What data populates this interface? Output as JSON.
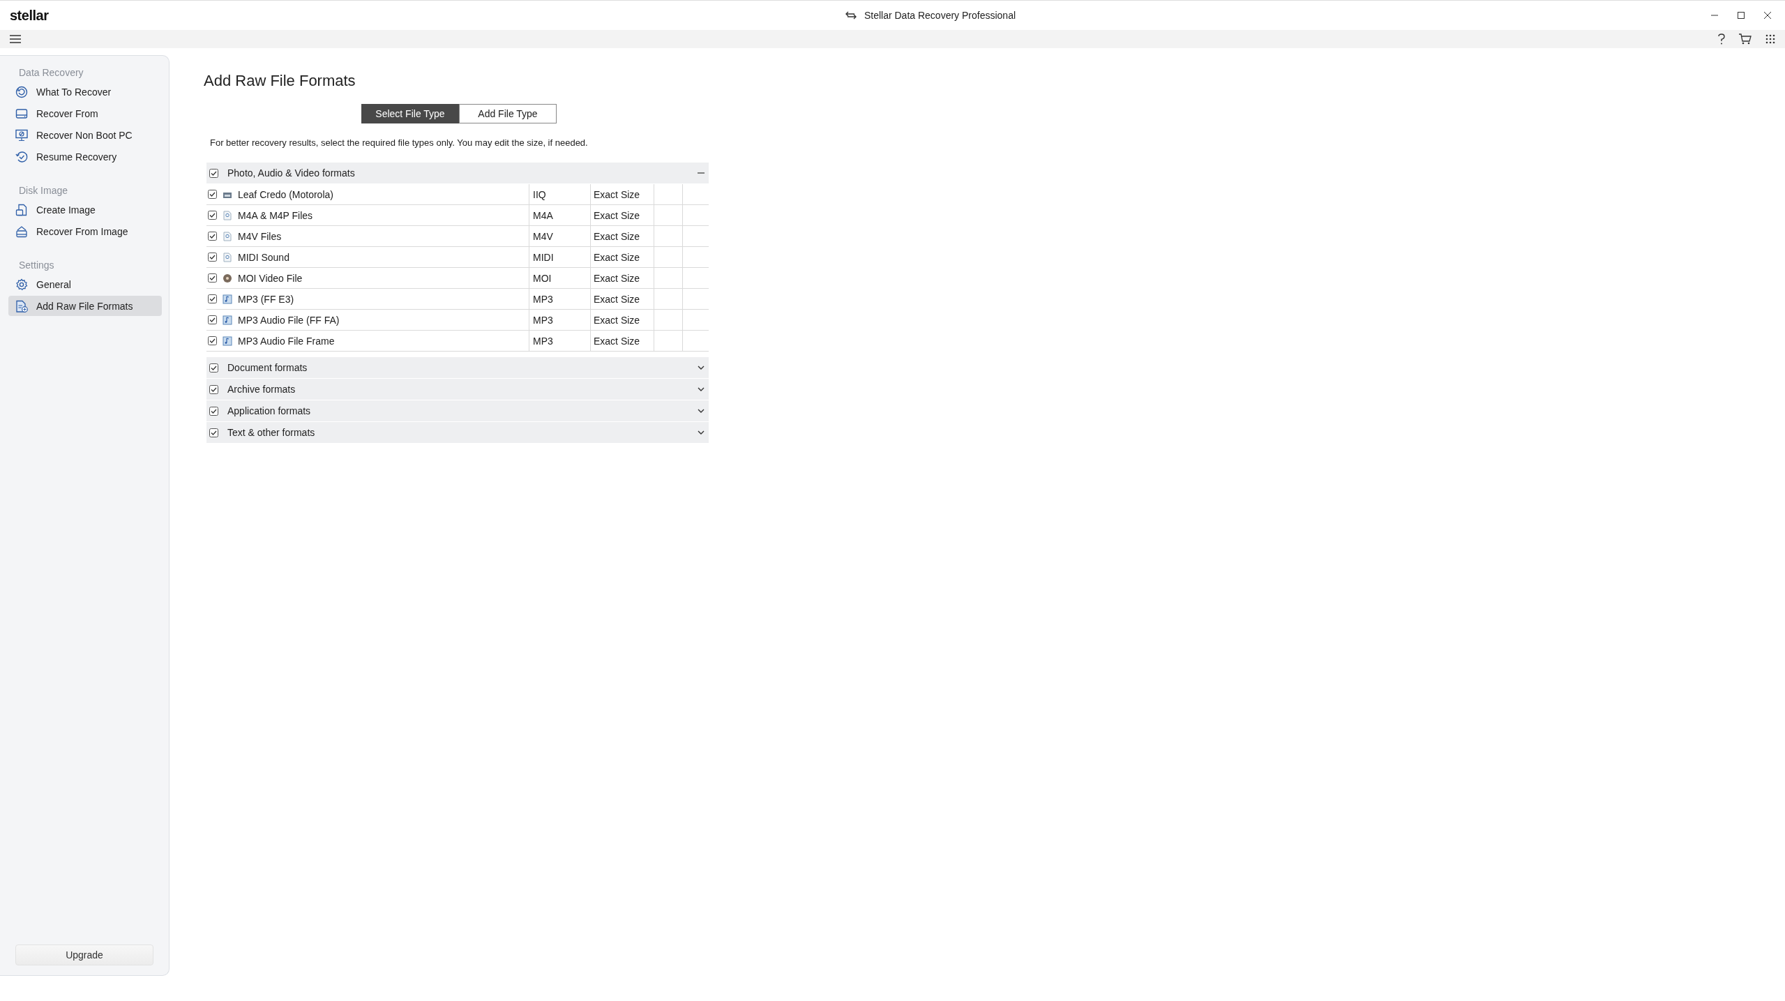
{
  "window": {
    "logo": "stellar",
    "title": "Stellar Data Recovery Professional"
  },
  "sidebar": {
    "sections": [
      {
        "heading": "Data Recovery",
        "items": [
          {
            "label": "What To Recover",
            "selected": false
          },
          {
            "label": "Recover From",
            "selected": false
          },
          {
            "label": "Recover Non Boot PC",
            "selected": false
          },
          {
            "label": "Resume Recovery",
            "selected": false
          }
        ]
      },
      {
        "heading": "Disk Image",
        "items": [
          {
            "label": "Create Image",
            "selected": false
          },
          {
            "label": "Recover From Image",
            "selected": false
          }
        ]
      },
      {
        "heading": "Settings",
        "items": [
          {
            "label": "General",
            "selected": false
          },
          {
            "label": "Add Raw File Formats",
            "selected": true
          }
        ]
      }
    ],
    "upgrade_button": "Upgrade"
  },
  "page": {
    "title": "Add Raw File Formats",
    "tabs": [
      {
        "label": "Select File Type",
        "selected": true
      },
      {
        "label": "Add File Type",
        "selected": false
      }
    ],
    "description": "For better recovery results, select the required file types only. You may edit the size, if needed.",
    "groups": [
      {
        "name": "Photo, Audio & Video formats",
        "checked": true,
        "expanded": true,
        "rows": [
          {
            "name": "Leaf Credo (Motorola)",
            "extension": "IIQ",
            "size": "Exact Size",
            "checked": true
          },
          {
            "name": "M4A & M4P Files",
            "extension": "M4A",
            "size": "Exact Size",
            "checked": true
          },
          {
            "name": "M4V Files",
            "extension": "M4V",
            "size": "Exact Size",
            "checked": true
          },
          {
            "name": "MIDI Sound",
            "extension": "MIDI",
            "size": "Exact Size",
            "checked": true
          },
          {
            "name": "MOI Video File",
            "extension": "MOI",
            "size": "Exact Size",
            "checked": true
          },
          {
            "name": "MP3 (FF E3)",
            "extension": "MP3",
            "size": "Exact Size",
            "checked": true
          },
          {
            "name": "MP3 Audio File (FF FA)",
            "extension": "MP3",
            "size": "Exact Size",
            "checked": true
          },
          {
            "name": "MP3 Audio File Frame",
            "extension": "MP3",
            "size": "Exact Size",
            "checked": true
          }
        ]
      },
      {
        "name": "Document formats",
        "checked": true,
        "expanded": false
      },
      {
        "name": "Archive formats",
        "checked": true,
        "expanded": false
      },
      {
        "name": "Application formats",
        "checked": true,
        "expanded": false
      },
      {
        "name": "Text & other formats",
        "checked": true,
        "expanded": false
      }
    ]
  }
}
